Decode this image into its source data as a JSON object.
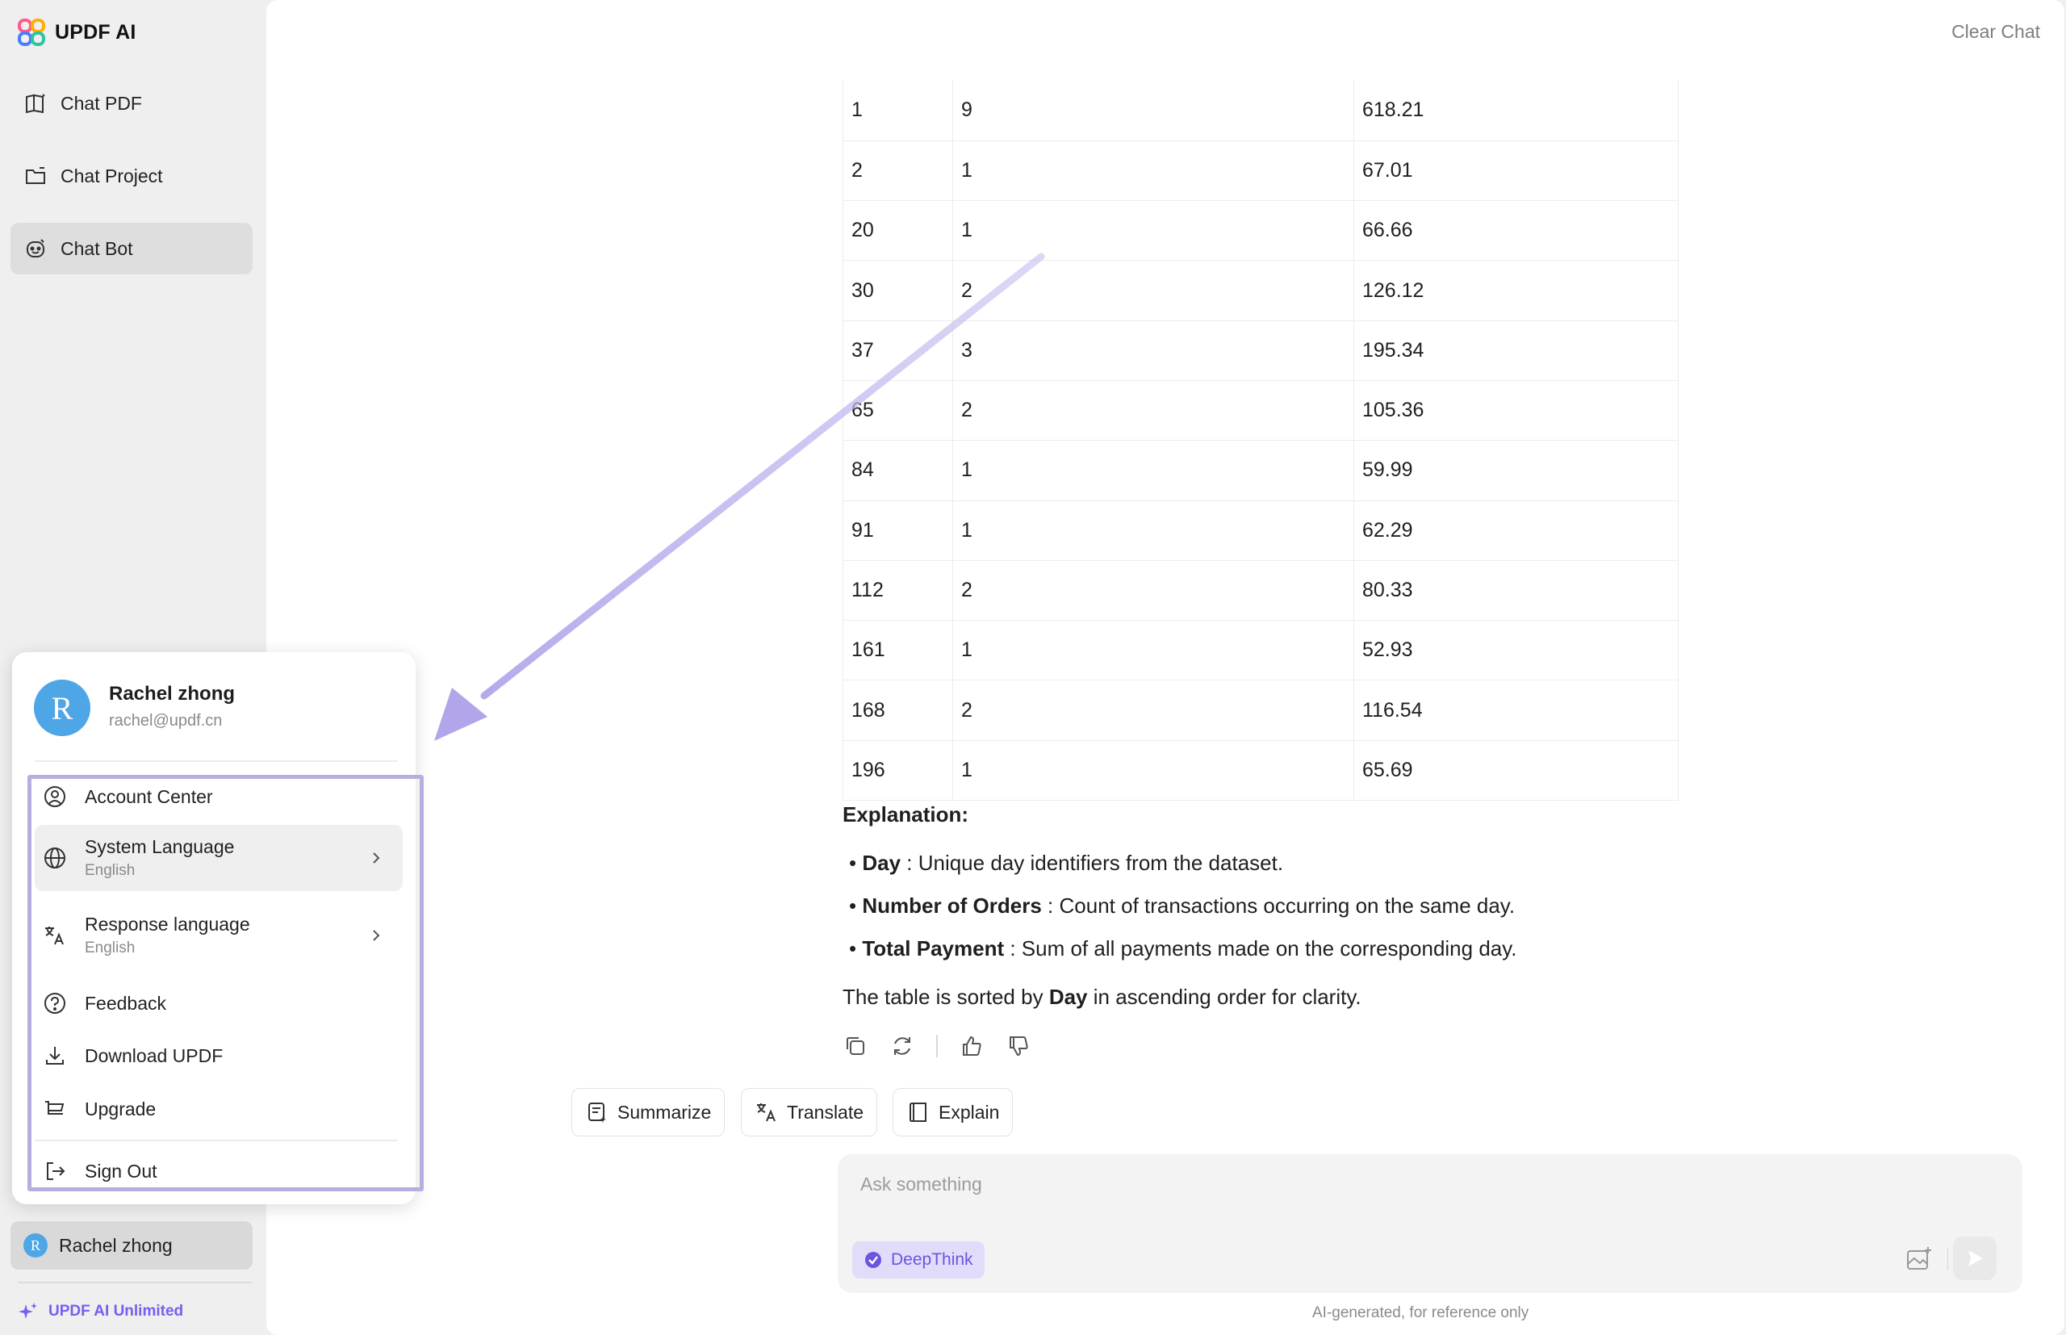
{
  "app": {
    "brand": "UPDF AI",
    "accent": "#7a5cf0"
  },
  "sidebar": {
    "items": [
      {
        "label": "Chat PDF",
        "icon": "book-icon"
      },
      {
        "label": "Chat Project",
        "icon": "folder-icon"
      },
      {
        "label": "Chat Bot",
        "icon": "bot-icon",
        "active": true
      }
    ],
    "user": {
      "initial": "R",
      "name": "Rachel zhong"
    },
    "unlimited_label": "UPDF AI Unlimited"
  },
  "header": {
    "clear_chat": "Clear Chat"
  },
  "table": {
    "rows": [
      [
        "1",
        "9",
        "618.21"
      ],
      [
        "2",
        "1",
        "67.01"
      ],
      [
        "20",
        "1",
        "66.66"
      ],
      [
        "30",
        "2",
        "126.12"
      ],
      [
        "37",
        "3",
        "195.34"
      ],
      [
        "65",
        "2",
        "105.36"
      ],
      [
        "84",
        "1",
        "59.99"
      ],
      [
        "91",
        "1",
        "62.29"
      ],
      [
        "112",
        "2",
        "80.33"
      ],
      [
        "161",
        "1",
        "52.93"
      ],
      [
        "168",
        "2",
        "116.54"
      ],
      [
        "196",
        "1",
        "65.69"
      ]
    ]
  },
  "explanation": {
    "title": "Explanation:",
    "bullets": [
      {
        "term": "Day",
        "text": " : Unique day identifiers from the dataset."
      },
      {
        "term": "Number of Orders",
        "text": " : Count of transactions occurring on the same day."
      },
      {
        "term": "Total Payment",
        "text": " : Sum of all payments made on the corresponding day."
      }
    ],
    "sorted_prefix": "The table is sorted by ",
    "sorted_term": "Day",
    "sorted_suffix": " in ascending order for clarity."
  },
  "chips": {
    "summarize": "Summarize",
    "translate": "Translate",
    "explain": "Explain"
  },
  "composer": {
    "placeholder": "Ask something",
    "deepthink": "DeepThink",
    "disclaimer": "AI-generated, for reference only"
  },
  "popup": {
    "initial": "R",
    "name": "Rachel zhong",
    "email": "rachel@updf.cn",
    "menu": {
      "account_center": "Account Center",
      "system_language": "System Language",
      "system_language_value": "English",
      "response_language": "Response language",
      "response_language_value": "English",
      "feedback": "Feedback",
      "download": "Download UPDF",
      "upgrade": "Upgrade",
      "sign_out": "Sign Out"
    }
  }
}
